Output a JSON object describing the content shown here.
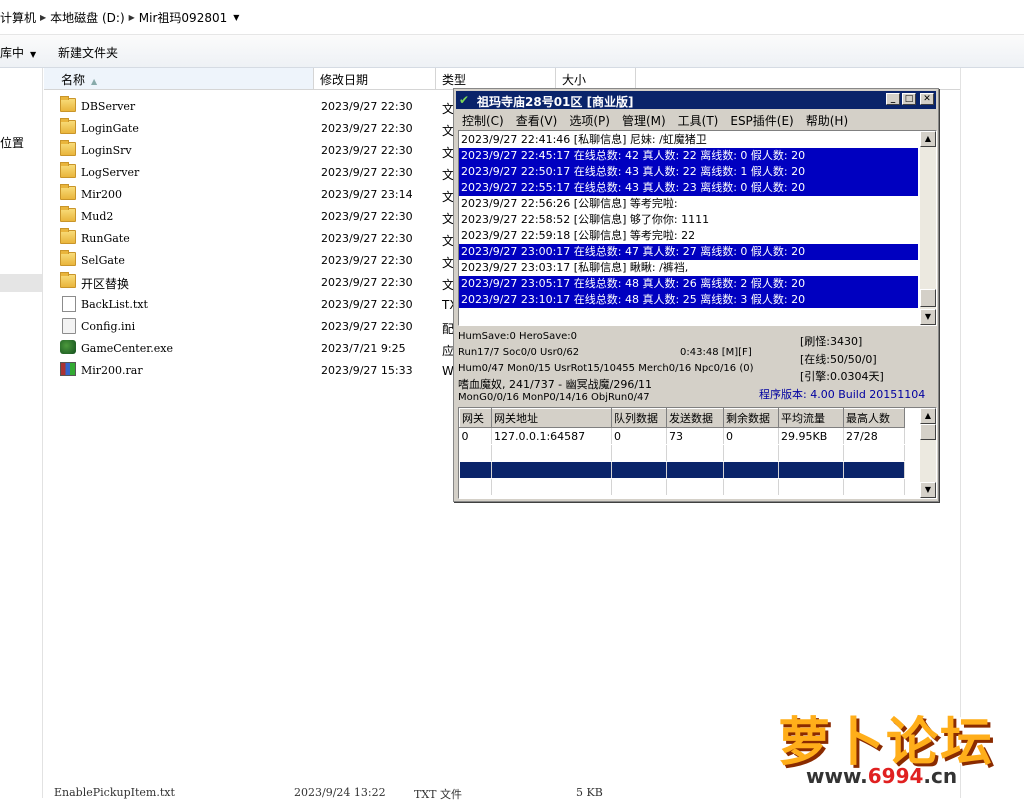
{
  "address": {
    "crumbs": [
      "计算机",
      "本地磁盘 (D:)",
      "Mir祖玛092801"
    ]
  },
  "toolbar": {
    "library_label": "库中",
    "new_folder_label": "新建文件夹"
  },
  "nav": {
    "position_label": "位置"
  },
  "columns": {
    "name": "名称",
    "date": "修改日期",
    "type": "类型",
    "size": "大小"
  },
  "files": [
    {
      "name": "DBServer",
      "date": "2023/9/27 22:30",
      "type": "文",
      "icon": "folder-icon"
    },
    {
      "name": "LoginGate",
      "date": "2023/9/27 22:30",
      "type": "文",
      "icon": "folder-icon"
    },
    {
      "name": "LoginSrv",
      "date": "2023/9/27 22:30",
      "type": "文",
      "icon": "folder-icon"
    },
    {
      "name": "LogServer",
      "date": "2023/9/27 22:30",
      "type": "文",
      "icon": "folder-icon"
    },
    {
      "name": "Mir200",
      "date": "2023/9/27 23:14",
      "type": "文",
      "icon": "folder-icon"
    },
    {
      "name": "Mud2",
      "date": "2023/9/27 22:30",
      "type": "文",
      "icon": "folder-icon"
    },
    {
      "name": "RunGate",
      "date": "2023/9/27 22:30",
      "type": "文",
      "icon": "folder-icon"
    },
    {
      "name": "SelGate",
      "date": "2023/9/27 22:30",
      "type": "文",
      "icon": "folder-icon"
    },
    {
      "name": "开区替换",
      "date": "2023/9/27 22:30",
      "type": "文",
      "icon": "folder-icon"
    },
    {
      "name": "BackList.txt",
      "date": "2023/9/27 22:30",
      "type": "TX",
      "icon": "text-file-icon"
    },
    {
      "name": "Config.ini",
      "date": "2023/9/27 22:30",
      "type": "配",
      "icon": "config-file-icon"
    },
    {
      "name": "GameCenter.exe",
      "date": "2023/7/21 9:25",
      "type": "应",
      "icon": "app-icon"
    },
    {
      "name": "Mir200.rar",
      "date": "2023/9/27 15:33",
      "type": "Wi",
      "icon": "archive-icon"
    }
  ],
  "bottom_row": {
    "name": "EnablePickupItem.txt",
    "date": "2023/9/24 13:22",
    "type": "TXT 文件",
    "size": "5 KB"
  },
  "window": {
    "title": "祖玛寺庙28号01区 [商业版]",
    "menu": [
      "控制(C)",
      "查看(V)",
      "选项(P)",
      "管理(M)",
      "工具(T)",
      "ESP插件(E)",
      "帮助(H)"
    ],
    "log": [
      {
        "text": "2023/9/27 22:41:46 [私聊信息] 尼妹: /虹魔猪卫",
        "hl": false
      },
      {
        "text": "2023/9/27 22:45:17 在线总数: 42 真人数: 22 离线数: 0 假人数: 20",
        "hl": true
      },
      {
        "text": "2023/9/27 22:50:17 在线总数: 43 真人数: 22 离线数: 1 假人数: 20",
        "hl": true
      },
      {
        "text": "2023/9/27 22:55:17 在线总数: 43 真人数: 23 离线数: 0 假人数: 20",
        "hl": true
      },
      {
        "text": "2023/9/27 22:56:26 [公聊信息] 等考完啦:",
        "hl": false
      },
      {
        "text": "2023/9/27 22:58:52 [公聊信息] 够了你你: 1111",
        "hl": false
      },
      {
        "text": "2023/9/27 22:59:18 [公聊信息] 等考完啦: 22",
        "hl": false
      },
      {
        "text": "2023/9/27 23:00:17 在线总数: 47 真人数: 27 离线数: 0 假人数: 20",
        "hl": true
      },
      {
        "text": "2023/9/27 23:03:17 [私聊信息] 瞅瞅: /裤裆,",
        "hl": false
      },
      {
        "text": "2023/9/27 23:05:17 在线总数: 48 真人数: 26 离线数: 2 假人数: 20",
        "hl": true
      },
      {
        "text": "2023/9/27 23:10:17 在线总数: 48 真人数: 25 离线数: 3 假人数: 20",
        "hl": true
      }
    ],
    "stats": {
      "line1": "HumSave:0 HeroSave:0",
      "line2": "Run17/7 Soc0/0 Usr0/62",
      "uptime": "0:43:48 [M][F]",
      "line3": "Hum0/47 Mon0/15 UsrRot15/10455 Merch0/16 Npc0/16 (0)",
      "line4": "嗜血魔奴, 241/737 - 幽冥战魔/296/11",
      "line5": "MonG0/0/16 MonP0/14/16 ObjRun0/47",
      "refresh": "[刷怪:3430]",
      "online": "[在线:50/50/0]",
      "engine": "[引擎:0.0304天]",
      "version": "程序版本: 4.00 Build 20151104"
    },
    "grid": {
      "headers": [
        "网关",
        "网关地址",
        "队列数据",
        "发送数据",
        "剩余数据",
        "平均流量",
        "最高人数"
      ],
      "rows": [
        [
          "0",
          "127.0.0.1:64587",
          "0",
          "73",
          "0",
          "29.95KB",
          "27/28"
        ]
      ]
    }
  },
  "watermark": {
    "brand": "萝卜论坛",
    "url_prefix": "www.",
    "url_number": "6994",
    "url_suffix": ".cn"
  }
}
